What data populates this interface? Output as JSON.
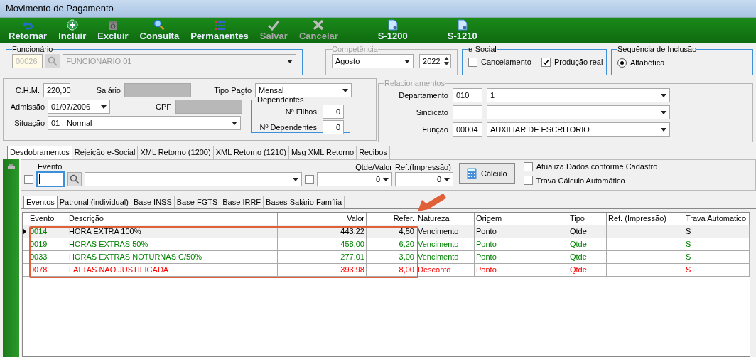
{
  "window": {
    "title": "Movimento de Pagamento"
  },
  "toolbar": [
    {
      "label": "Retornar",
      "kind": "back",
      "disabled": false
    },
    {
      "label": "Incluir",
      "kind": "add",
      "disabled": false
    },
    {
      "label": "Excluir",
      "kind": "delete",
      "disabled": false
    },
    {
      "label": "Consulta",
      "kind": "search",
      "disabled": false
    },
    {
      "label": "Permanentes",
      "kind": "list",
      "disabled": false
    },
    {
      "label": "Salvar",
      "kind": "save",
      "disabled": true
    },
    {
      "label": "Cancelar",
      "kind": "cancel",
      "disabled": true
    },
    {
      "label": "S-1200",
      "kind": "doc",
      "disabled": false
    },
    {
      "label": "S-1210",
      "kind": "doc",
      "disabled": false
    }
  ],
  "funcionario": {
    "title": "Funcionário",
    "code": "00026",
    "name": "FUNCIONARIO 01"
  },
  "competencia": {
    "title": "Competência",
    "month": "Agosto",
    "year": "2022"
  },
  "esocial": {
    "title": "e-Social",
    "options": [
      {
        "label": "Cancelamento",
        "checked": false
      },
      {
        "label": "Produção real",
        "checked": true
      }
    ]
  },
  "sequencia": {
    "title": "Sequência de Inclusão",
    "options": [
      {
        "label": "Alfabética",
        "selected": true
      }
    ]
  },
  "dados": {
    "chm_label": "C.H.M.",
    "chm": "220,00",
    "salario_label": "Salário",
    "tipo_label": "Tipo Pagto",
    "tipo": "Mensal",
    "admissao_label": "Admissão",
    "admissao": "01/07/2006",
    "cpf_label": "CPF",
    "situacao_label": "Situação",
    "situacao": "01 - Normal",
    "dependentes": {
      "title": "Dependentes",
      "filhos_label": "Nº Filhos",
      "filhos": "0",
      "dep_label": "Nº Dependentes",
      "dep": "0"
    }
  },
  "relacionamentos": {
    "title": "Relacionamentos",
    "rows": [
      {
        "label": "Departamento",
        "code": "010",
        "value": "1"
      },
      {
        "label": "Sindicato",
        "code": "",
        "value": ""
      },
      {
        "label": "Função",
        "code": "00004",
        "value": "AUXILIAR DE ESCRITORIO"
      }
    ]
  },
  "tabs": [
    {
      "label": "Desdobramentos",
      "selected": true
    },
    {
      "label": "Rejeição e-Social",
      "selected": false
    },
    {
      "label": "XML Retorno (1200)",
      "selected": false
    },
    {
      "label": "XML Retorno (1210)",
      "selected": false
    },
    {
      "label": "Msg XML Retorno",
      "selected": false
    },
    {
      "label": "Recibos",
      "selected": false
    }
  ],
  "evento_bar": {
    "evento_checked": false,
    "desc_checked": false,
    "evento_label": "Evento",
    "qtde_label": "Qtde/Valor",
    "qtde": "0",
    "ref_label": "Ref.(Impressão)",
    "ref": "0",
    "calc_button": "Cálculo",
    "options": [
      {
        "label": "Atualiza Dados conforme Cadastro",
        "checked": false
      },
      {
        "label": "Trava Cálculo Automático",
        "checked": false
      }
    ]
  },
  "subtabs": [
    {
      "label": "Eventos",
      "selected": true
    },
    {
      "label": "Patronal (individual)",
      "selected": false
    },
    {
      "label": "Base INSS",
      "selected": false
    },
    {
      "label": "Base FGTS",
      "selected": false
    },
    {
      "label": "Base IRRF",
      "selected": false
    },
    {
      "label": "Bases Salário Família",
      "selected": false
    }
  ],
  "table": {
    "columns": [
      "Evento",
      "Descrição",
      "Valor",
      "Refer.",
      "Natureza",
      "Origem",
      "Tipo",
      "Ref. (Impressão)",
      "Trava Automatico"
    ],
    "rows": [
      {
        "cells": [
          "0014",
          "HORA EXTRA 100%",
          "443,22",
          "4,50",
          "Vencimento",
          "Ponto",
          "Qtde",
          "",
          "S"
        ],
        "color": "#008000",
        "selected": true
      },
      {
        "cells": [
          "0019",
          "HORAS EXTRAS 50%",
          "458,00",
          "6,20",
          "Vencimento",
          "Ponto",
          "Qtde",
          "",
          "S"
        ],
        "color": "#008000",
        "selected": false
      },
      {
        "cells": [
          "0033",
          "HORAS EXTRAS NOTURNAS C/50%",
          "277,01",
          "3,00",
          "Vencimento",
          "Ponto",
          "Qtde",
          "",
          "S"
        ],
        "color": "#008000",
        "selected": false
      },
      {
        "cells": [
          "0078",
          "FALTAS NAO JUSTIFICADA",
          "393,98",
          "8,00",
          "Desconto",
          "Ponto",
          "Qtde",
          "",
          "S"
        ],
        "color": "#ff0000",
        "selected": false
      }
    ]
  }
}
